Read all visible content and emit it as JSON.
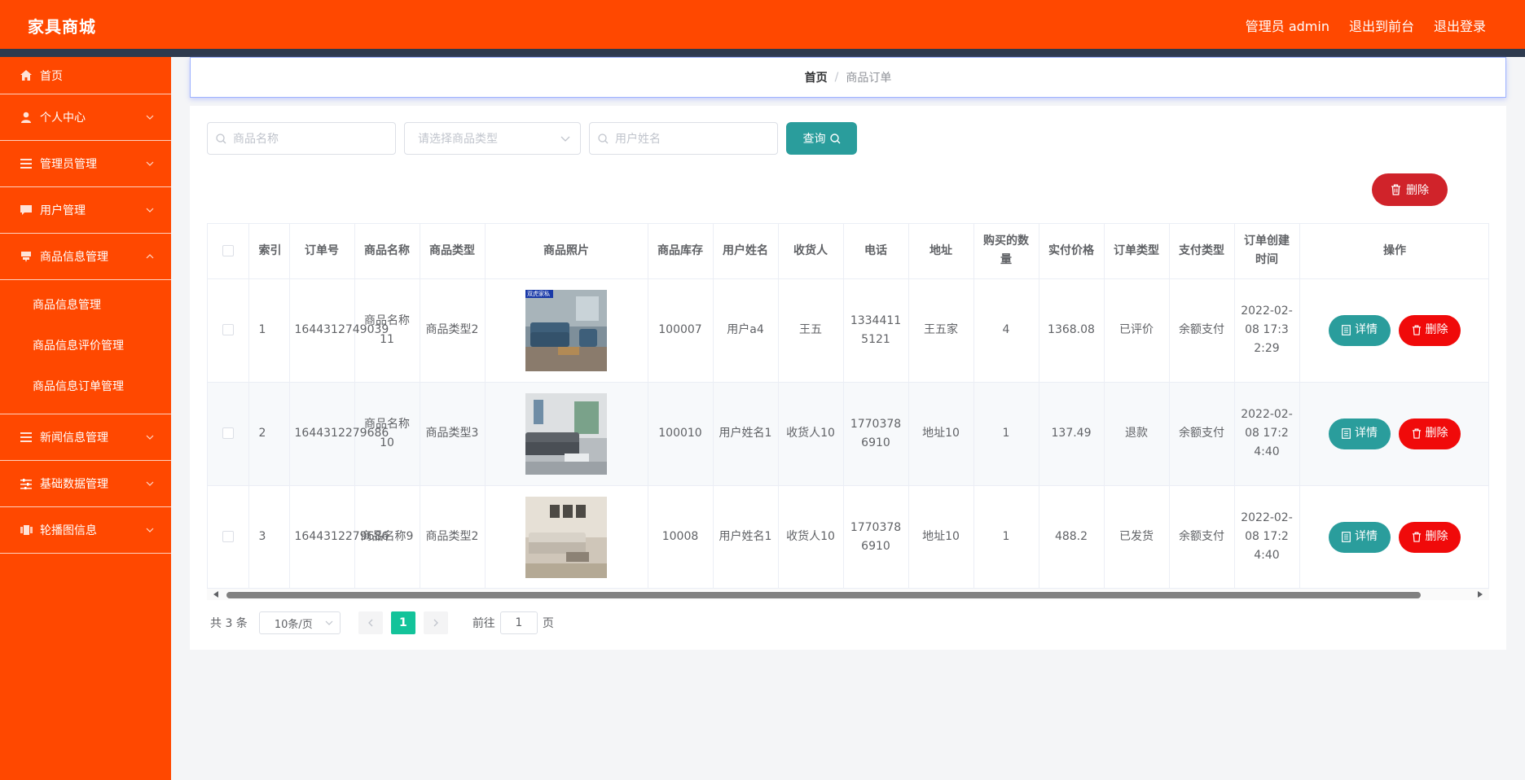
{
  "header": {
    "brand": "家具商城",
    "admin_label": "管理员 admin",
    "to_front": "退出到前台",
    "logout": "退出登录"
  },
  "colors": {
    "primary": "#ff4800",
    "teal": "#2a9d9c",
    "danger": "#f00a0a",
    "page_active": "#13c39a"
  },
  "sidebar": {
    "items": [
      {
        "label": "首页",
        "icon": "home-icon"
      },
      {
        "label": "个人中心",
        "icon": "user-icon"
      },
      {
        "label": "管理员管理",
        "icon": "list-icon"
      },
      {
        "label": "用户管理",
        "icon": "chat-icon"
      },
      {
        "label": "商品信息管理",
        "icon": "goods-icon"
      },
      {
        "label": "新闻信息管理",
        "icon": "list-icon"
      },
      {
        "label": "基础数据管理",
        "icon": "sliders-icon"
      },
      {
        "label": "轮播图信息",
        "icon": "carousel-icon"
      }
    ],
    "subitems": [
      "商品信息管理",
      "商品信息评价管理",
      "商品信息订单管理"
    ]
  },
  "breadcrumb": {
    "home": "首页",
    "separator": "/",
    "current": "商品订单"
  },
  "search": {
    "goods_name_placeholder": "商品名称",
    "goods_type_placeholder": "请选择商品类型",
    "user_name_placeholder": "用户姓名",
    "query_label": "查询"
  },
  "toolbar": {
    "delete_label": "删除"
  },
  "table": {
    "columns": [
      "索引",
      "订单号",
      "商品名称",
      "商品类型",
      "商品照片",
      "商品库存",
      "用户姓名",
      "收货人",
      "电话",
      "地址",
      "购买的数量",
      "实付价格",
      "订单类型",
      "支付类型",
      "订单创建时间",
      "操作"
    ],
    "rows": [
      {
        "index": "1",
        "order_no": "1644312749039",
        "goods_name": "商品名称11",
        "goods_type": "商品类型2",
        "stock": "100007",
        "user_name": "用户a4",
        "receiver": "王五",
        "phone": "13344115121",
        "address": "王五家",
        "qty": "4",
        "price": "1368.08",
        "order_type": "已评价",
        "pay_type": "余额支付",
        "created": "2022-02-08 17:32:29",
        "photo_badge": "双虎家私"
      },
      {
        "index": "2",
        "order_no": "1644312279686",
        "goods_name": "商品名称10",
        "goods_type": "商品类型3",
        "stock": "100010",
        "user_name": "用户姓名1",
        "receiver": "收货人10",
        "phone": "17703786910",
        "address": "地址10",
        "qty": "1",
        "price": "137.49",
        "order_type": "退款",
        "pay_type": "余额支付",
        "created": "2022-02-08 17:24:40"
      },
      {
        "index": "3",
        "order_no": "1644312279686",
        "goods_name": "商品名称9",
        "goods_type": "商品类型2",
        "stock": "10008",
        "user_name": "用户姓名1",
        "receiver": "收货人10",
        "phone": "17703786910",
        "address": "地址10",
        "qty": "1",
        "price": "488.2",
        "order_type": "已发货",
        "pay_type": "余额支付",
        "created": "2022-02-08 17:24:40"
      }
    ],
    "detail_label": "详情",
    "delete_label": "删除"
  },
  "pagination": {
    "total": "共 3 条",
    "page_size": "10条/页",
    "current_page": "1",
    "goto_label": "前往",
    "goto_value": "1",
    "page_suffix": "页"
  }
}
